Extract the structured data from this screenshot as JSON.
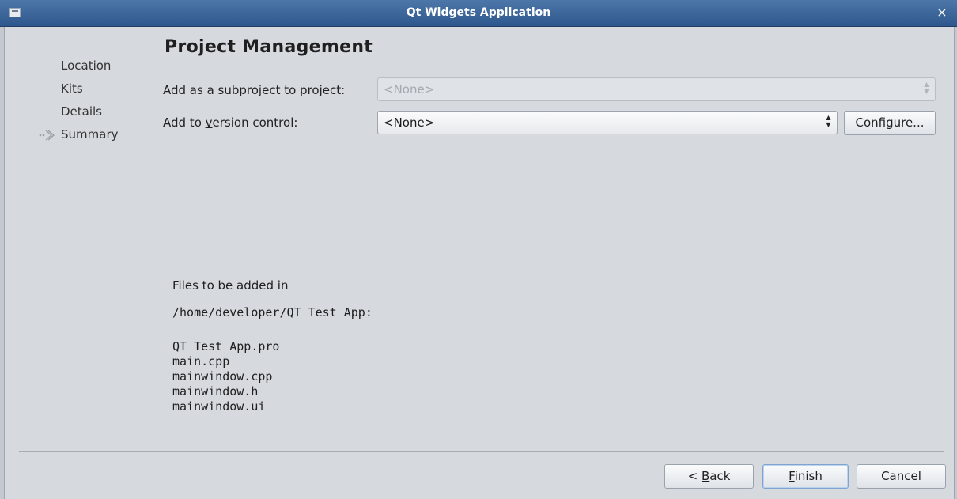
{
  "window": {
    "title": "Qt Widgets Application",
    "close_icon": "×"
  },
  "steps": [
    {
      "label": "Location",
      "current": false
    },
    {
      "label": "Kits",
      "current": false
    },
    {
      "label": "Details",
      "current": false
    },
    {
      "label": "Summary",
      "current": true
    }
  ],
  "step_arrow": "◦⊱",
  "page": {
    "title": "Project Management"
  },
  "form": {
    "subproject_label": "Add as a subproject to project:",
    "subproject_value": "<None>",
    "version_control_label_pre": "Add to ",
    "version_control_label_mnemonic": "v",
    "version_control_label_post": "ersion control:",
    "version_control_value": "<None>",
    "configure_label": "Configure..."
  },
  "files": {
    "intro": "Files to be added in",
    "path": "/home/developer/QT_Test_App:",
    "list": [
      "QT_Test_App.pro",
      "main.cpp",
      "mainwindow.cpp",
      "mainwindow.h",
      "mainwindow.ui"
    ]
  },
  "buttons": {
    "back_pre": "< ",
    "back_mnemonic": "B",
    "back_post": "ack",
    "finish_mnemonic": "F",
    "finish_post": "inish",
    "cancel": "Cancel"
  }
}
